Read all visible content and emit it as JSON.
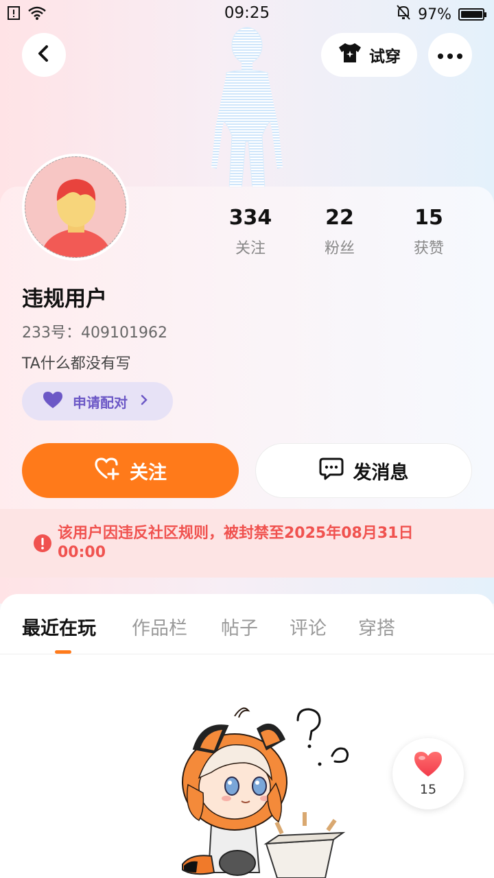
{
  "status_bar": {
    "time": "09:25",
    "battery": "97%",
    "battery_level": 0.97
  },
  "header": {
    "try_on_label": "试穿"
  },
  "profile": {
    "stats": [
      {
        "value": "334",
        "label": "关注"
      },
      {
        "value": "22",
        "label": "粉丝"
      },
      {
        "value": "15",
        "label": "获赞"
      }
    ],
    "username": "违规用户",
    "user_id": "233号：409101962",
    "bio": "TA什么都没有写",
    "pair_label": "申请配对"
  },
  "actions": {
    "follow_label": "关注",
    "message_label": "发消息"
  },
  "ban_notice": "该用户因违反社区规则，被封禁至2025年08月31日 00:00",
  "tabs": [
    {
      "label": "最近在玩"
    },
    {
      "label": "作品栏"
    },
    {
      "label": "帖子"
    },
    {
      "label": "评论"
    },
    {
      "label": "穿搭"
    }
  ],
  "like_bubble": {
    "count": "15"
  },
  "colors": {
    "accent": "#ff7a1a",
    "ban_red": "#f0524f",
    "pair_purple": "#6c58c6"
  },
  "icons": [
    "back-arrow-icon",
    "shirt-icon",
    "more-icon",
    "heart-icon",
    "heart-plus-icon",
    "chat-icon",
    "warning-icon",
    "chevron-right-icon"
  ]
}
